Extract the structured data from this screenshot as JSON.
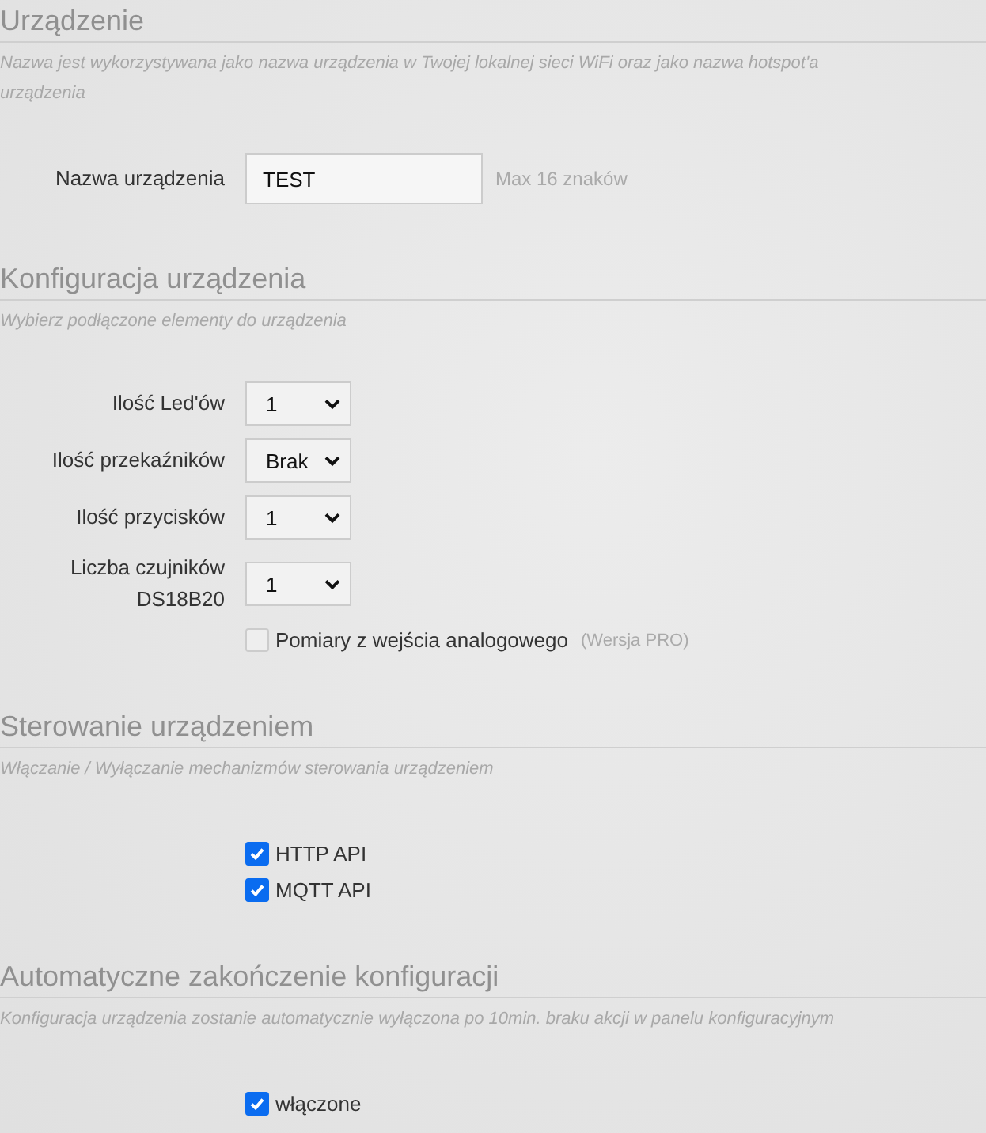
{
  "sections": [
    {
      "title": "Urządzenie",
      "description": "Nazwa jest wykorzystywana jako nazwa urządzenia w Twojej lokalnej sieci WiFi oraz jako nazwa hotspot'a urządzenia",
      "rows": [
        {
          "kind": "text",
          "label": "Nazwa urządzenia",
          "value": "TEST",
          "hint": "Max 16 znaków"
        }
      ]
    },
    {
      "title": "Konfiguracja urządzenia",
      "description": "Wybierz podłączone elementy do urządzenia",
      "rows": [
        {
          "kind": "select",
          "label": "Ilość Led'ów",
          "value": "1"
        },
        {
          "kind": "select",
          "label": "Ilość przekaźników",
          "value": "Brak"
        },
        {
          "kind": "select",
          "label": "Ilość przycisków",
          "value": "1"
        },
        {
          "kind": "select",
          "label": "Liczba czujników DS18B20",
          "value": "1"
        },
        {
          "kind": "checkbox",
          "text": "Pomiary z wejścia analogowego",
          "checked": false,
          "disabled": true,
          "note": "(Wersja PRO)"
        }
      ]
    },
    {
      "title": "Sterowanie urządzeniem",
      "description": "Włączanie / Wyłączanie mechanizmów sterowania urządzeniem",
      "rows": [
        {
          "kind": "checkbox",
          "text": "HTTP API",
          "checked": true,
          "disabled": false
        },
        {
          "kind": "checkbox",
          "text": "MQTT API",
          "checked": true,
          "disabled": false
        }
      ]
    },
    {
      "title": "Automatyczne zakończenie konfiguracji",
      "description": "Konfiguracja urządzenia zostanie automatycznie wyłączona po 10min. braku akcji w panelu konfiguracyjnym",
      "rows": [
        {
          "kind": "checkbox",
          "text": "włączone",
          "checked": true,
          "disabled": false
        }
      ]
    }
  ]
}
